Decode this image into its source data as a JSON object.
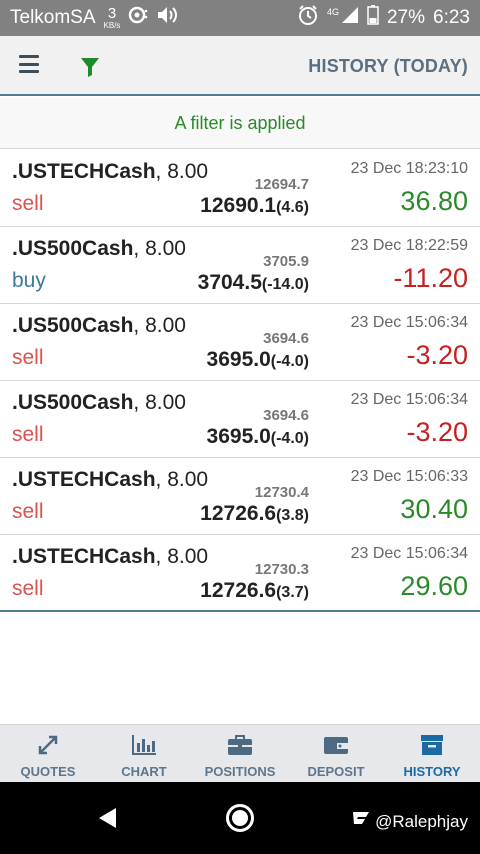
{
  "status_bar": {
    "carrier": "TelkomSA",
    "speed_value": "3",
    "speed_unit": "KB/s",
    "network": "4G",
    "battery": "27%",
    "time": "6:23"
  },
  "app_bar": {
    "title": "HISTORY (TODAY)"
  },
  "filter_banner": {
    "text": "A filter is applied"
  },
  "trades": [
    {
      "symbol": ".USTECHCash",
      "volume": ", 8.00",
      "side": "sell",
      "open_price": "12694.7",
      "close_price": "12690.1",
      "points": "(4.6)",
      "time": "23 Dec 18:23:10",
      "profit": "36.80",
      "profit_sign": "pos"
    },
    {
      "symbol": ".US500Cash",
      "volume": ", 8.00",
      "side": "buy",
      "open_price": "3705.9",
      "close_price": "3704.5",
      "points": "(-14.0)",
      "time": "23 Dec 18:22:59",
      "profit": "-11.20",
      "profit_sign": "neg"
    },
    {
      "symbol": ".US500Cash",
      "volume": ", 8.00",
      "side": "sell",
      "open_price": "3694.6",
      "close_price": "3695.0",
      "points": "(-4.0)",
      "time": "23 Dec 15:06:34",
      "profit": "-3.20",
      "profit_sign": "neg"
    },
    {
      "symbol": ".US500Cash",
      "volume": ", 8.00",
      "side": "sell",
      "open_price": "3694.6",
      "close_price": "3695.0",
      "points": "(-4.0)",
      "time": "23 Dec 15:06:34",
      "profit": "-3.20",
      "profit_sign": "neg"
    },
    {
      "symbol": ".USTECHCash",
      "volume": ", 8.00",
      "side": "sell",
      "open_price": "12730.4",
      "close_price": "12726.6",
      "points": "(3.8)",
      "time": "23 Dec 15:06:33",
      "profit": "30.40",
      "profit_sign": "pos"
    },
    {
      "symbol": ".USTECHCash",
      "volume": ", 8.00",
      "side": "sell",
      "open_price": "12730.3",
      "close_price": "12726.6",
      "points": "(3.7)",
      "time": "23 Dec 15:06:34",
      "profit": "29.60",
      "profit_sign": "pos"
    }
  ],
  "bottom_nav": [
    {
      "label": "QUOTES",
      "icon": "arrows-expand-icon",
      "active": false
    },
    {
      "label": "CHART",
      "icon": "bar-chart-icon",
      "active": false
    },
    {
      "label": "POSITIONS",
      "icon": "briefcase-icon",
      "active": false
    },
    {
      "label": "DEPOSIT",
      "icon": "wallet-icon",
      "active": false
    },
    {
      "label": "HISTORY",
      "icon": "archive-box-icon",
      "active": true
    }
  ],
  "watermark": {
    "handle": "@Ralephjay"
  },
  "colors": {
    "profit_positive": "#2a8a2a",
    "profit_negative": "#c62020",
    "sell": "#d9534f",
    "buy": "#3c7a9a",
    "accent": "#1c6aa3",
    "header_text": "#5b6f80"
  }
}
